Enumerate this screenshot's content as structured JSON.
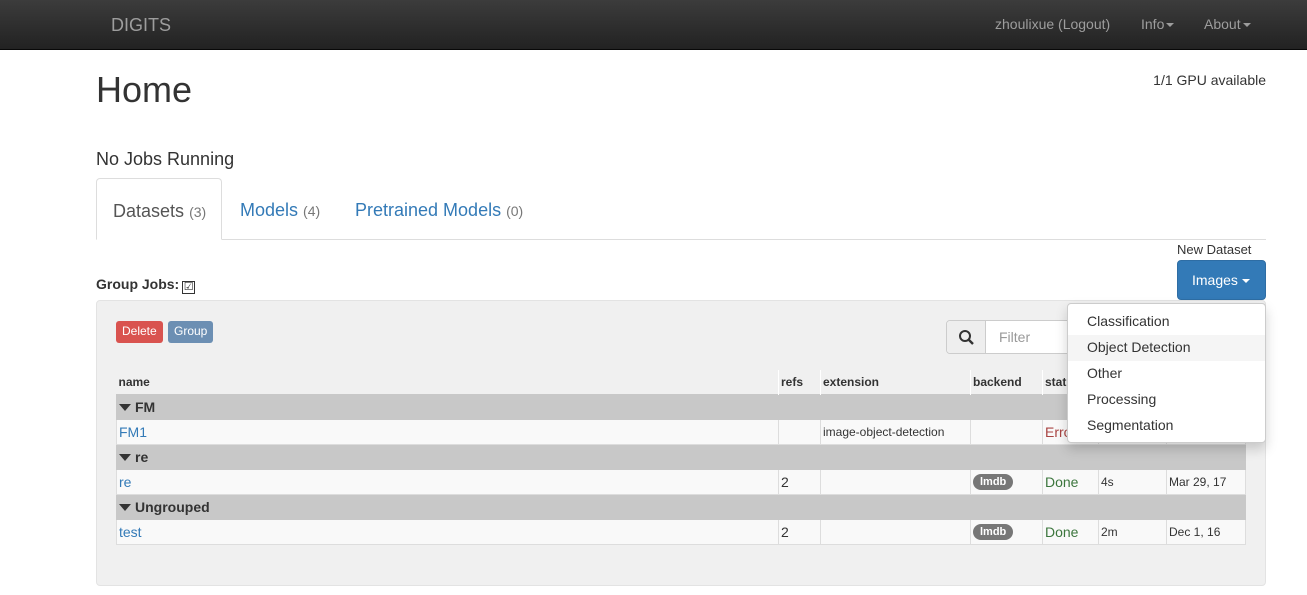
{
  "nav": {
    "brand": "DIGITS",
    "user": "zhoulixue (Logout)",
    "info": "Info",
    "about": "About"
  },
  "page": {
    "title": "Home",
    "gpu": "1/1 GPU available",
    "no_jobs": "No Jobs Running"
  },
  "tabs": [
    {
      "label": "Datasets",
      "count": "(3)"
    },
    {
      "label": "Models",
      "count": "(4)"
    },
    {
      "label": "Pretrained Models",
      "count": "(0)"
    }
  ],
  "new_dataset": {
    "label": "New Dataset",
    "button": "Images"
  },
  "group_jobs": {
    "label": "Group Jobs:",
    "checked": "☑"
  },
  "buttons": {
    "delete": "Delete",
    "group": "Group"
  },
  "filter": {
    "placeholder": "Filter"
  },
  "table": {
    "headers": [
      "name",
      "refs",
      "extension",
      "backend",
      "stat"
    ],
    "groups": [
      {
        "name": "FM",
        "rows": [
          {
            "name": "FM1",
            "refs": "",
            "extension": "image-object-detection",
            "backend": "",
            "status": "Erro",
            "elapsed": "",
            "date": ""
          }
        ]
      },
      {
        "name": "re",
        "rows": [
          {
            "name": "re",
            "refs": "2",
            "extension": "",
            "backend": "lmdb",
            "status": "Done",
            "elapsed": "4s",
            "date": "Mar 29, 17"
          }
        ]
      },
      {
        "name": "Ungrouped",
        "rows": [
          {
            "name": "test",
            "refs": "2",
            "extension": "",
            "backend": "lmdb",
            "status": "Done",
            "elapsed": "2m",
            "date": "Dec 1, 16"
          }
        ]
      }
    ]
  },
  "menu": {
    "items": [
      "Classification",
      "Object Detection",
      "Other",
      "Processing",
      "Segmentation"
    ],
    "highlighted": "Object Detection"
  },
  "colors": {
    "primary": "#337ab7",
    "danger": "#d9534f",
    "group_btn": "#6c8fb3",
    "done": "#3c763d",
    "error": "#a94442"
  }
}
